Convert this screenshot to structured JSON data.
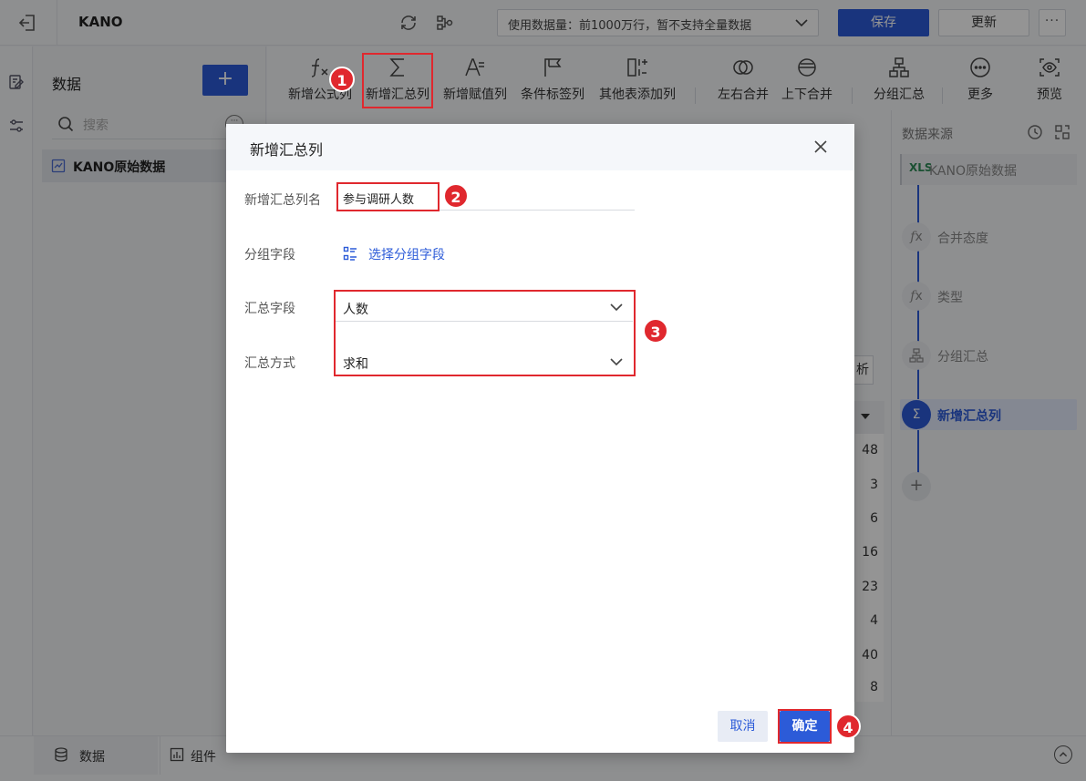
{
  "app": {
    "title": "KANO",
    "data_limit_select": "使用数据量：前1000万行，暂不支持全量数据",
    "save_label": "保存",
    "update_label": "更新",
    "more_label": "···"
  },
  "data_panel": {
    "title": "数据",
    "add_label": "+",
    "search_placeholder": "搜索",
    "dots_label": "···",
    "items": [
      {
        "label": "KANO原始数据"
      }
    ]
  },
  "toolbar": {
    "tools": [
      {
        "label": "新增公式列",
        "icon": "formula-icon"
      },
      {
        "label": "新增汇总列",
        "icon": "sigma-icon"
      },
      {
        "label": "新增赋值列",
        "icon": "assign-icon"
      },
      {
        "label": "条件标签列",
        "icon": "flag-icon"
      },
      {
        "label": "其他表添加列",
        "icon": "add-column-icon"
      },
      {
        "label": "左右合并",
        "icon": "horizontal-merge-icon"
      },
      {
        "label": "上下合并",
        "icon": "vertical-merge-icon"
      },
      {
        "label": "分组汇总",
        "icon": "group-summary-icon"
      },
      {
        "label": "更多",
        "icon": "more-icon"
      },
      {
        "label": "预览",
        "icon": "preview-icon"
      }
    ]
  },
  "background": {
    "button_fragment": "析",
    "table_values": [
      "48",
      "3",
      "6",
      "16",
      "23",
      "4",
      "40",
      "8"
    ]
  },
  "right_panel": {
    "title": "数据来源",
    "source": {
      "badge": "XLS",
      "label": "KANO原始数据"
    },
    "steps": [
      {
        "icon": "fx",
        "label": "合并态度"
      },
      {
        "icon": "fx",
        "label": "类型"
      },
      {
        "icon": "group",
        "label": "分组汇总"
      },
      {
        "icon": "sigma",
        "label": "新增汇总列"
      }
    ],
    "add_label": "+"
  },
  "bottom": {
    "tabs": [
      {
        "label": "数据"
      },
      {
        "label": "组件"
      }
    ]
  },
  "modal": {
    "title": "新增汇总列",
    "name_label": "新增汇总列名",
    "name_value": "参与调研人数",
    "group_label": "分组字段",
    "group_link": "选择分组字段",
    "summary_field_label": "汇总字段",
    "summary_field_value": "人数",
    "summary_method_label": "汇总方式",
    "summary_method_value": "求和",
    "cancel_label": "取消",
    "ok_label": "确定"
  },
  "annotations": [
    "1",
    "2",
    "3",
    "4"
  ],
  "colors": {
    "primary": "#2c5bd8",
    "annotation": "#e0282e"
  }
}
